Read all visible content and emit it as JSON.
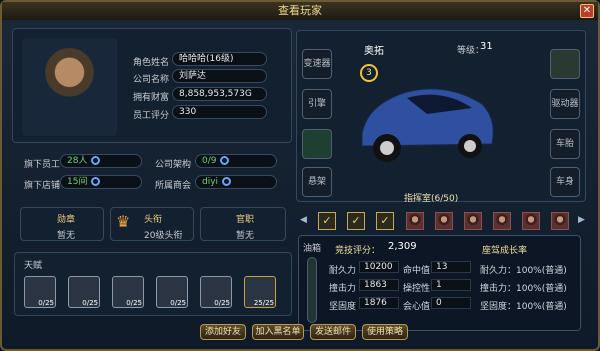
{
  "window": {
    "title": "查看玩家"
  },
  "profile": {
    "role_label": "角色姓名",
    "role_value": "哈哈哈(16级)",
    "company_label": "公司名称",
    "company_value": "刘萨达",
    "wealth_label": "拥有财富",
    "wealth_value": "8,858,953,573G",
    "score_label": "员工评分",
    "score_value": "330"
  },
  "org": {
    "staff_label": "旗下员工",
    "staff_value": "28人",
    "structure_label": "公司架构",
    "structure_value": "0/9",
    "stores_label": "旗下店铺",
    "stores_value": "15间",
    "chamber_label": "所属商会",
    "chamber_value": "diyi"
  },
  "honors": [
    {
      "title": "勋章",
      "value": "暂无"
    },
    {
      "title": "头衔",
      "value": "20级头衔"
    },
    {
      "title": "官职",
      "value": "暂无"
    }
  ],
  "talent": {
    "label": "天赋",
    "items": [
      "0/25",
      "0/25",
      "0/25",
      "0/25",
      "0/25",
      "25/25"
    ]
  },
  "car": {
    "name": "奥拓",
    "level_label": "等级：",
    "level": "31",
    "badge": "3",
    "garage": "指挥室(6/50)"
  },
  "left_slots": [
    "变速器",
    "引擎",
    "",
    "悬架"
  ],
  "right_slots": [
    "",
    "驱动器",
    "车胎",
    "车身"
  ],
  "stats": {
    "oil_label": "油箱",
    "score_label": "竞技评分：",
    "score": "2,309",
    "growth_label": "座驾成长率",
    "rows": [
      {
        "a_label": "耐久力",
        "a": "10200",
        "b_label": "命中值",
        "b": "13",
        "c": "耐久力：100%(普通)"
      },
      {
        "a_label": "撞击力",
        "a": "1863",
        "b_label": "操控性",
        "b": "1",
        "c": "撞击力：100%(普通)"
      },
      {
        "a_label": "坚固度",
        "a": "1876",
        "b_label": "会心值",
        "b": "0",
        "c": "坚固度：100%(普通)"
      }
    ]
  },
  "buttons": [
    "添加好友",
    "加入黑名单",
    "发送邮件",
    "使用策略"
  ]
}
